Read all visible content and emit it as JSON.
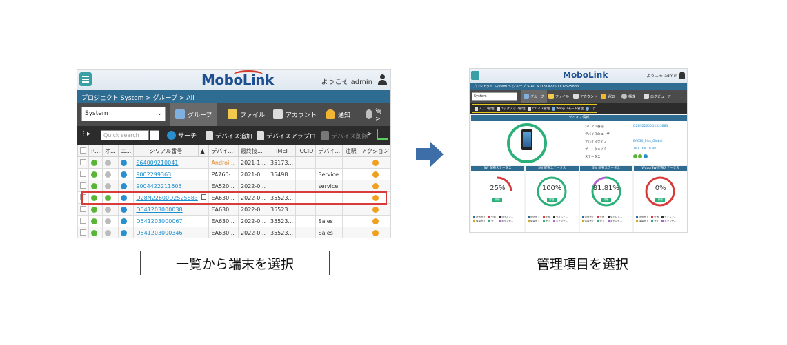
{
  "left_screen": {
    "logo": "MoboLink",
    "welcome": "ようこそ admin",
    "breadcrumb": "プロジェクト System  >  グループ  >  All",
    "group_select": "System",
    "nav_tabs": [
      "グループ",
      "ファイル",
      "アカウント",
      "通知",
      "管 >"
    ],
    "search_placeholder": "Quick search",
    "toolbar": [
      "サーチ",
      "デバイス追加",
      "デバイスアップロード",
      "デバイス削除",
      ">"
    ],
    "columns": [
      "R...",
      "オ...",
      "エ...",
      "シリアル番号",
      "▲",
      "デバイ...",
      "最終接...",
      "IMEI",
      "ICCID",
      "デバイ...",
      "注釈",
      "アクション"
    ],
    "rows": [
      {
        "serial": "S64009210041",
        "model": "Androi...",
        "last": "2021-1...",
        "imei": "35173...",
        "group": "",
        "online": "grey"
      },
      {
        "serial": "9002299363",
        "model": "PA760-...",
        "last": "2021-0...",
        "imei": "35498...",
        "group": "Service",
        "online": "grey"
      },
      {
        "serial": "9004422211605",
        "model": "EA520...",
        "last": "2022-0...",
        "imei": "",
        "group": "service",
        "online": "grey"
      },
      {
        "serial": "D28N22600D2525883",
        "model": "EA630...",
        "last": "2022-0...",
        "imei": "35523...",
        "group": "",
        "online": "green"
      },
      {
        "serial": "D541203000038",
        "model": "EA630...",
        "last": "2022-0...",
        "imei": "35523...",
        "group": "",
        "online": "grey"
      },
      {
        "serial": "D541203000067",
        "model": "EA630...",
        "last": "2022-0...",
        "imei": "35523...",
        "group": "Sales",
        "online": "grey"
      },
      {
        "serial": "D541203000346",
        "model": "EA630...",
        "last": "2022-0...",
        "imei": "35523...",
        "group": "Sales",
        "online": "grey"
      }
    ]
  },
  "right_screen": {
    "logo": "MoboLink",
    "welcome": "ようこそ admin",
    "breadcrumb": "プロジェクト System  >  グループ  >  All  >  D28N22600D2525883",
    "group_select": "System",
    "nav_tabs": [
      "グループ",
      "ファイル",
      "アカウント",
      "通知",
      "構成",
      "ログビューアー"
    ],
    "sub_tabs": [
      "アプリ管理",
      "バックアップ管理",
      "デバイス管理",
      "Wappリモート管理",
      "ログ"
    ],
    "panel_title": "デバイス情報",
    "info_labels": [
      "シリアル番号",
      "デバイスのユーザー",
      "デバイスタイプ",
      "ゲートウェイIP",
      "ステータス"
    ],
    "info_values": [
      "D28N22600D2525883",
      "",
      "EA630_Plus_Global",
      "192.168.10.88",
      ""
    ],
    "stats": [
      {
        "title": "SW 配布ステータス",
        "value": "25%",
        "btn": "詳細",
        "percent": 25,
        "color": "#d93a3a"
      },
      {
        "title": "SW 配布ステータス",
        "value": "100%",
        "btn": "詳細",
        "percent": 100,
        "color": "#2bb07a"
      },
      {
        "title": "SW 配布ステータス",
        "value": "81.81%",
        "btn": "詳細",
        "percent": 81.81,
        "color": "#2bb07a"
      },
      {
        "title": "Wapp/SW 配布ステータス",
        "value": "0%",
        "btn": "詳細",
        "percent": 0,
        "color": "#d93a3a"
      }
    ],
    "legend": [
      "送信完了",
      "失敗",
      "タイムア...",
      "保留完了",
      "完了",
      "キャンセ..."
    ]
  },
  "captions": {
    "left": "一覧から端末を選択",
    "right": "管理項目を選択"
  },
  "colors": {
    "header_blue": "#2f6c92",
    "dark_bar": "#4b4b4b",
    "arrow": "#3d6ea8",
    "highlight_red": "#d93a3a",
    "highlight_yellow": "#e2c81e",
    "link": "#1a8fd0"
  }
}
